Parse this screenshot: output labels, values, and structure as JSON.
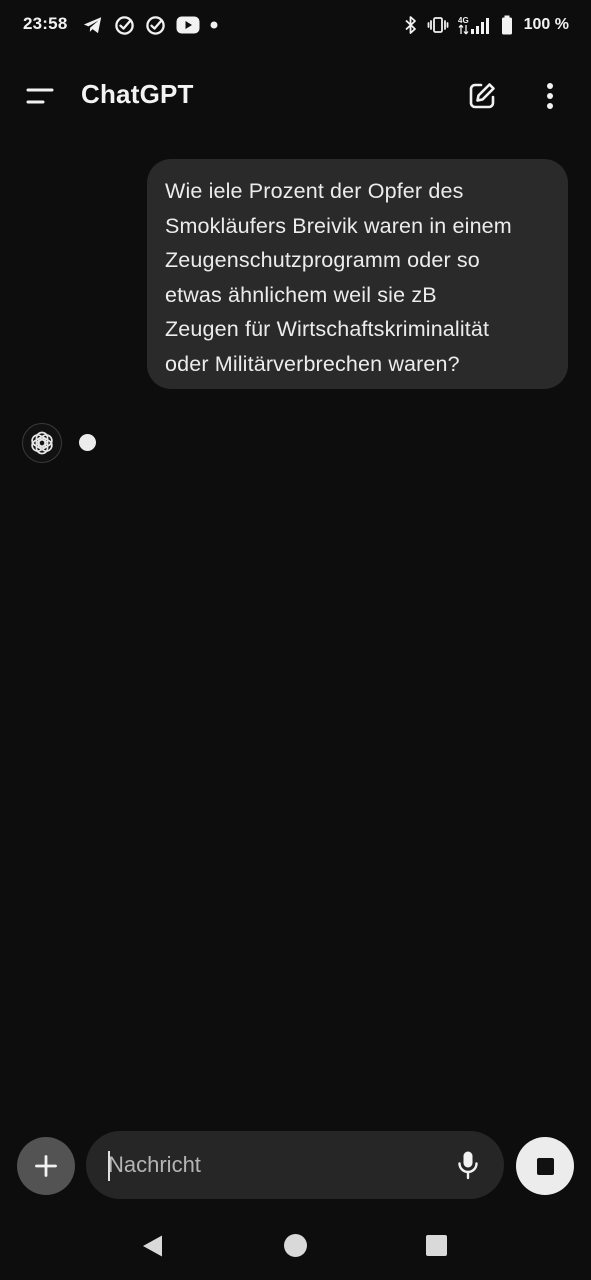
{
  "status_bar": {
    "time": "23:58",
    "left_icons": [
      "telegram-icon",
      "check-circle-icon",
      "check-circle-icon",
      "youtube-icon",
      "dot-icon"
    ],
    "right_icons": [
      "bluetooth-icon",
      "vibrate-icon",
      "signal-icon",
      "battery-icon"
    ],
    "network_label": "4G",
    "battery": "100 %"
  },
  "header": {
    "title": "ChatGPT",
    "menu_icon": "menu-icon",
    "new_chat_icon": "edit-icon",
    "more_icon": "more-vertical-icon"
  },
  "messages": [
    {
      "role": "user",
      "lines": [
        "Wie iele Prozent der Opfer des",
        "Smokläufers Breivik waren in einem",
        "Zeugenschutzprogramm oder so",
        "etwas ähnlichem weil sie zB",
        "Zeugen für Wirtschaftskriminalität",
        "oder Militärverbrechen waren?"
      ]
    },
    {
      "role": "assistant",
      "state": "typing"
    }
  ],
  "composer": {
    "placeholder": "Nachricht",
    "value": "",
    "plus_icon": "plus-icon",
    "mic_icon": "mic-icon",
    "stop_icon": "stop-icon"
  },
  "nav_bar": {
    "back_icon": "back-triangle-icon",
    "home_icon": "home-circle-icon",
    "recents_icon": "recents-square-icon"
  },
  "colors": {
    "background": "#0d0d0d",
    "bubble": "#2a2a2a",
    "input": "#262626",
    "plus_button": "#535353",
    "stop_button": "#ececec",
    "text": "#ececec"
  }
}
